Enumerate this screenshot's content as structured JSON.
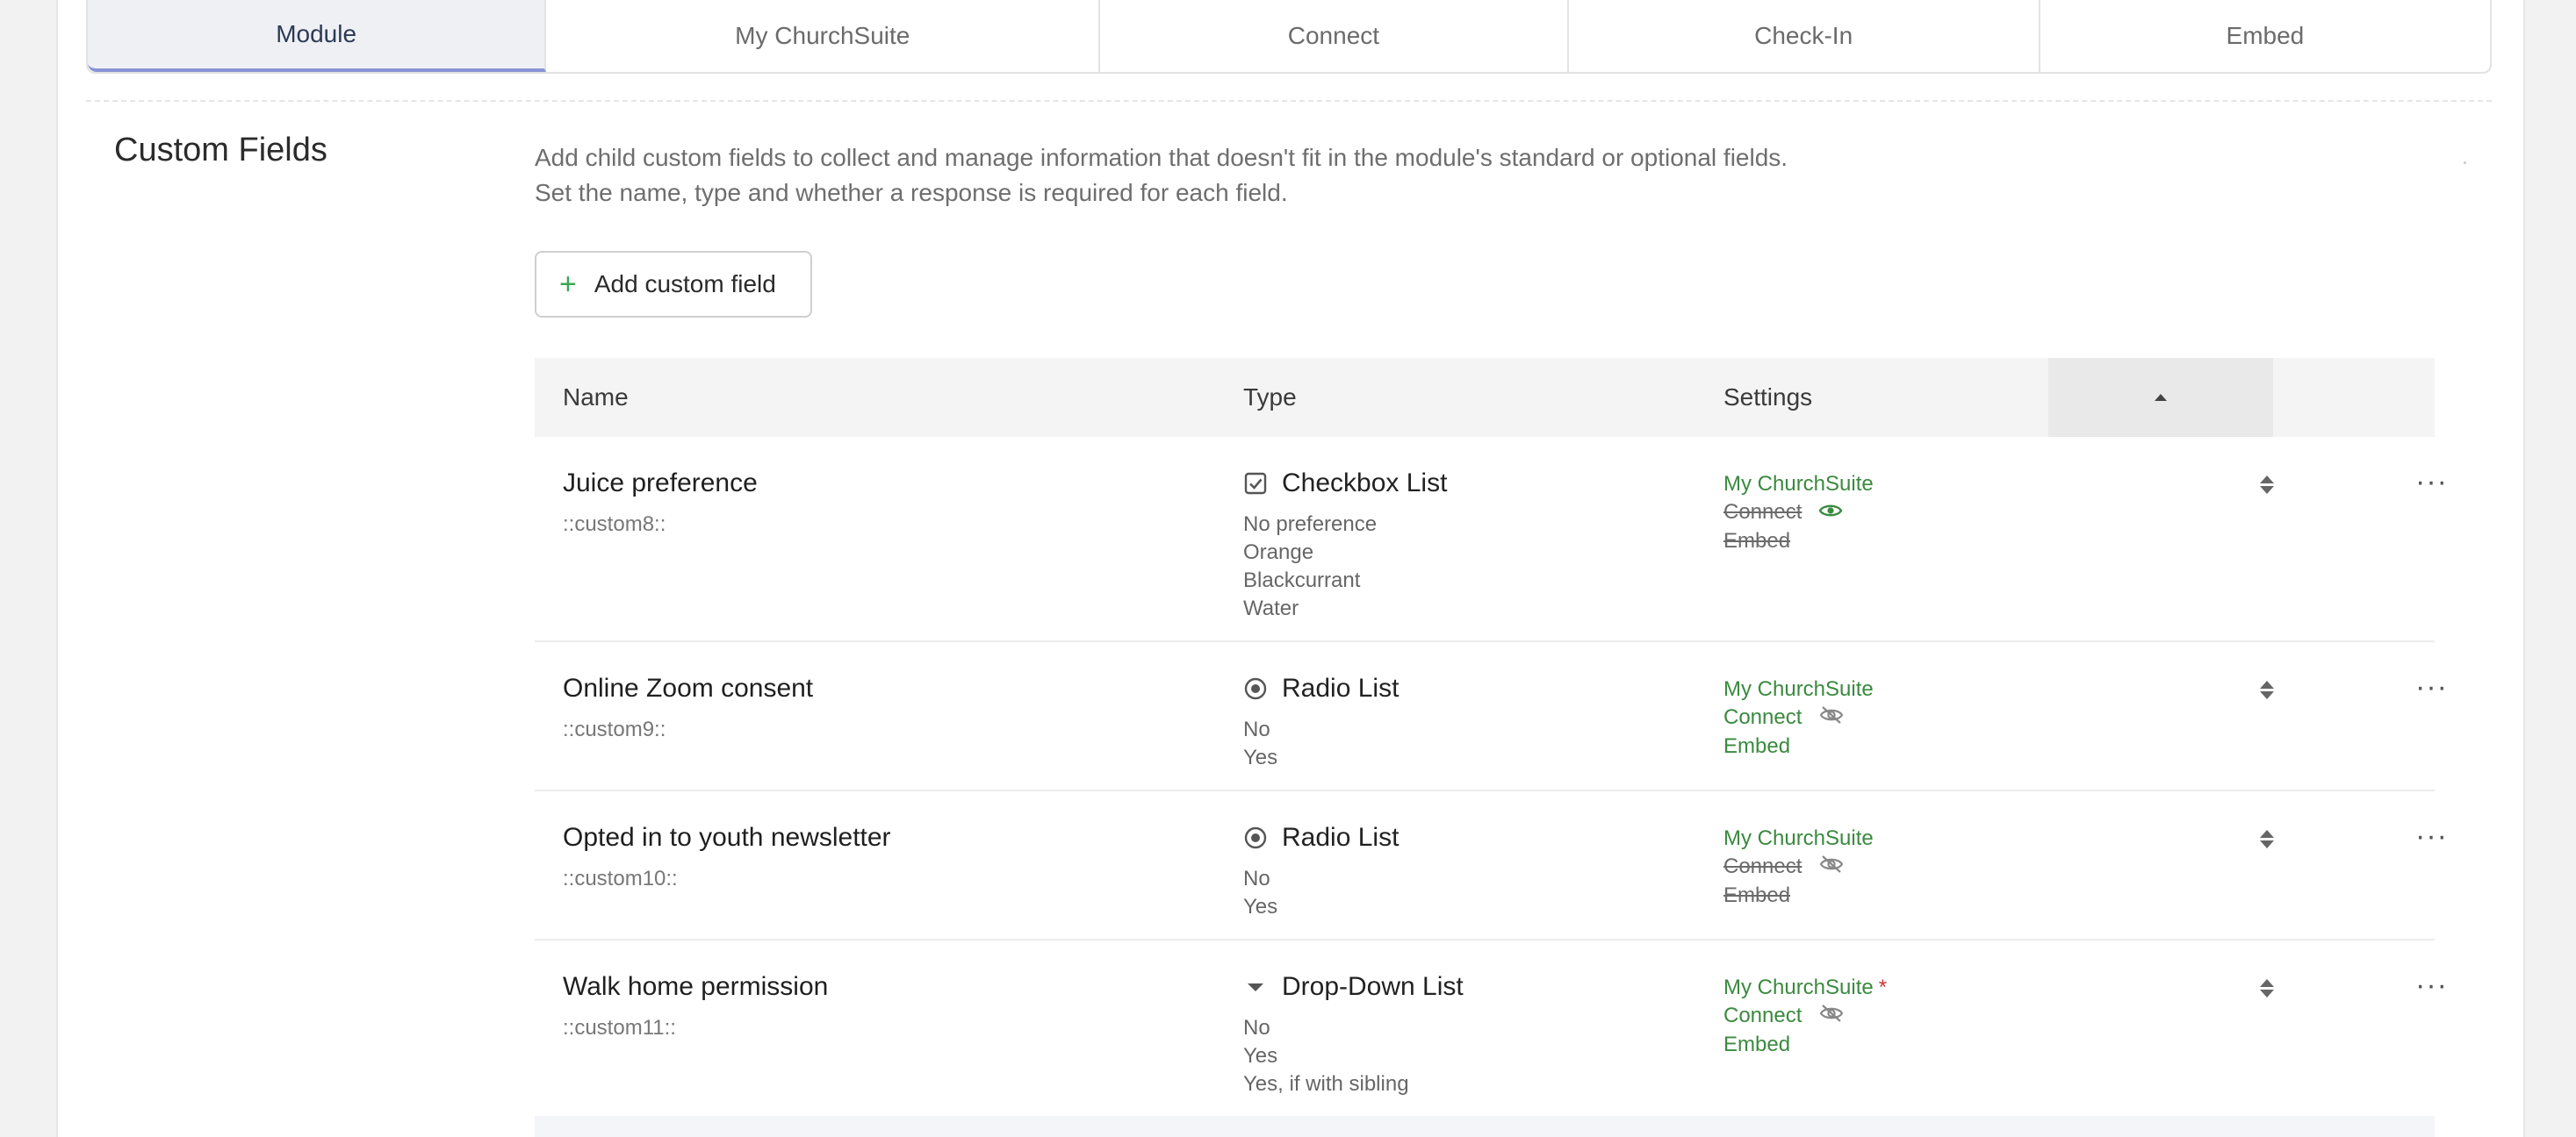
{
  "tabs": [
    {
      "label": "Module",
      "active": true
    },
    {
      "label": "My ChurchSuite",
      "active": false
    },
    {
      "label": "Connect",
      "active": false
    },
    {
      "label": "Check-In",
      "active": false
    },
    {
      "label": "Embed",
      "active": false
    }
  ],
  "section": {
    "title": "Custom Fields",
    "description_line1": "Add child custom fields to collect and manage information that doesn't fit in the module's standard or optional fields.",
    "description_line2": "Set the name, type and whether a response is required for each field.",
    "add_button_label": "Add custom field"
  },
  "table": {
    "headers": {
      "name": "Name",
      "type": "Type",
      "settings": "Settings"
    },
    "rows": [
      {
        "name": "Juice preference",
        "code": "::custom8::",
        "type": "Checkbox List",
        "type_icon": "checkbox-icon",
        "options": [
          "No preference",
          "Orange",
          "Blackcurrant",
          "Water"
        ],
        "settings": {
          "mychurchsuite": "My ChurchSuite",
          "connect": "Connect",
          "embed": "Embed"
        }
      },
      {
        "name": "Online Zoom consent",
        "code": "::custom9::",
        "type": "Radio List",
        "type_icon": "radio-icon",
        "options": [
          "No",
          "Yes"
        ],
        "settings": {
          "mychurchsuite": "My ChurchSuite",
          "connect": "Connect",
          "embed": "Embed"
        }
      },
      {
        "name": "Opted in to youth newsletter",
        "code": "::custom10::",
        "type": "Radio List",
        "type_icon": "radio-icon",
        "options": [
          "No",
          "Yes"
        ],
        "settings": {
          "mychurchsuite": "My ChurchSuite",
          "connect": "Connect",
          "embed": "Embed"
        }
      },
      {
        "name": "Walk home permission",
        "code": "::custom11::",
        "type": "Drop-Down List",
        "type_icon": "dropdown-caret-icon",
        "options": [
          "No",
          "Yes",
          "Yes, if with sibling"
        ],
        "settings": {
          "mychurchsuite": "My ChurchSuite",
          "required_mark": "*",
          "connect": "Connect",
          "embed": "Embed"
        }
      }
    ]
  },
  "colors": {
    "accent_green": "#3a8a3f",
    "tab_active_underline": "#8a93d6",
    "required_red": "#cc3333"
  }
}
